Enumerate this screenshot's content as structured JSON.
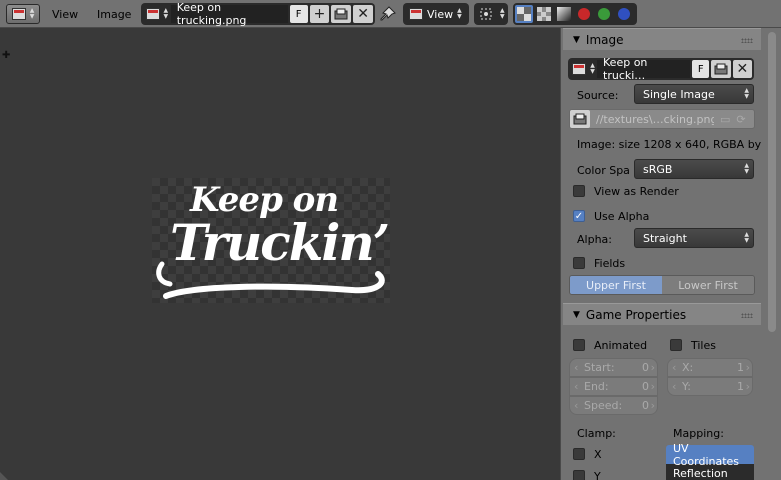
{
  "header": {
    "editor_type_icon": "image-editor-icon",
    "menus": [
      "View",
      "Image"
    ],
    "image_name": "Keep on trucking.png",
    "fake_user": "F",
    "new_icon": "plus-icon",
    "open_icon": "folder-open-icon",
    "unlink_icon": "close-icon",
    "pin_icon": "pin-icon",
    "mode_value": "View",
    "pivot_icon": "pivot-icon",
    "channels": [
      "rgb-alpha",
      "alpha",
      "z-buffer",
      "red",
      "green",
      "blue"
    ]
  },
  "viewport": {
    "image_text_line1": "Keep on",
    "image_text_line2": "Truckin’"
  },
  "panel": {
    "image_section": {
      "title": "Image",
      "datablock_name": "Keep on trucki…",
      "fake_user": "F",
      "source_label": "Source:",
      "source_value": "Single Image",
      "filepath": "//textures\\…cking.png",
      "info_text": "Image: size 1208 x 640, RGBA by",
      "colorspace_label": "Color Spa",
      "colorspace_value": "sRGB",
      "view_as_render_label": "View as Render",
      "view_as_render": false,
      "use_alpha_label": "Use Alpha",
      "use_alpha": true,
      "alpha_label": "Alpha:",
      "alpha_value": "Straight",
      "fields_label": "Fields",
      "fields": false,
      "field_order": [
        "Upper First",
        "Lower First"
      ]
    },
    "game_section": {
      "title": "Game Properties",
      "animated_label": "Animated",
      "animated": false,
      "tiles_label": "Tiles",
      "tiles": false,
      "start_label": "Start:",
      "start_value": "0",
      "end_label": "End:",
      "end_value": "0",
      "speed_label": "Speed:",
      "speed_value": "0",
      "x_label": "X:",
      "x_value": "1",
      "y_label": "Y:",
      "y_value": "1",
      "clamp_label": "Clamp:",
      "clamp_x_label": "X",
      "clamp_y_label": "Y",
      "mapping_label": "Mapping:",
      "mapping_options": [
        "UV Coordinates",
        "Reflection"
      ]
    }
  },
  "colors": {
    "accent": "#5680c2",
    "header_bg": "#727272",
    "viewport_bg": "#393939"
  }
}
